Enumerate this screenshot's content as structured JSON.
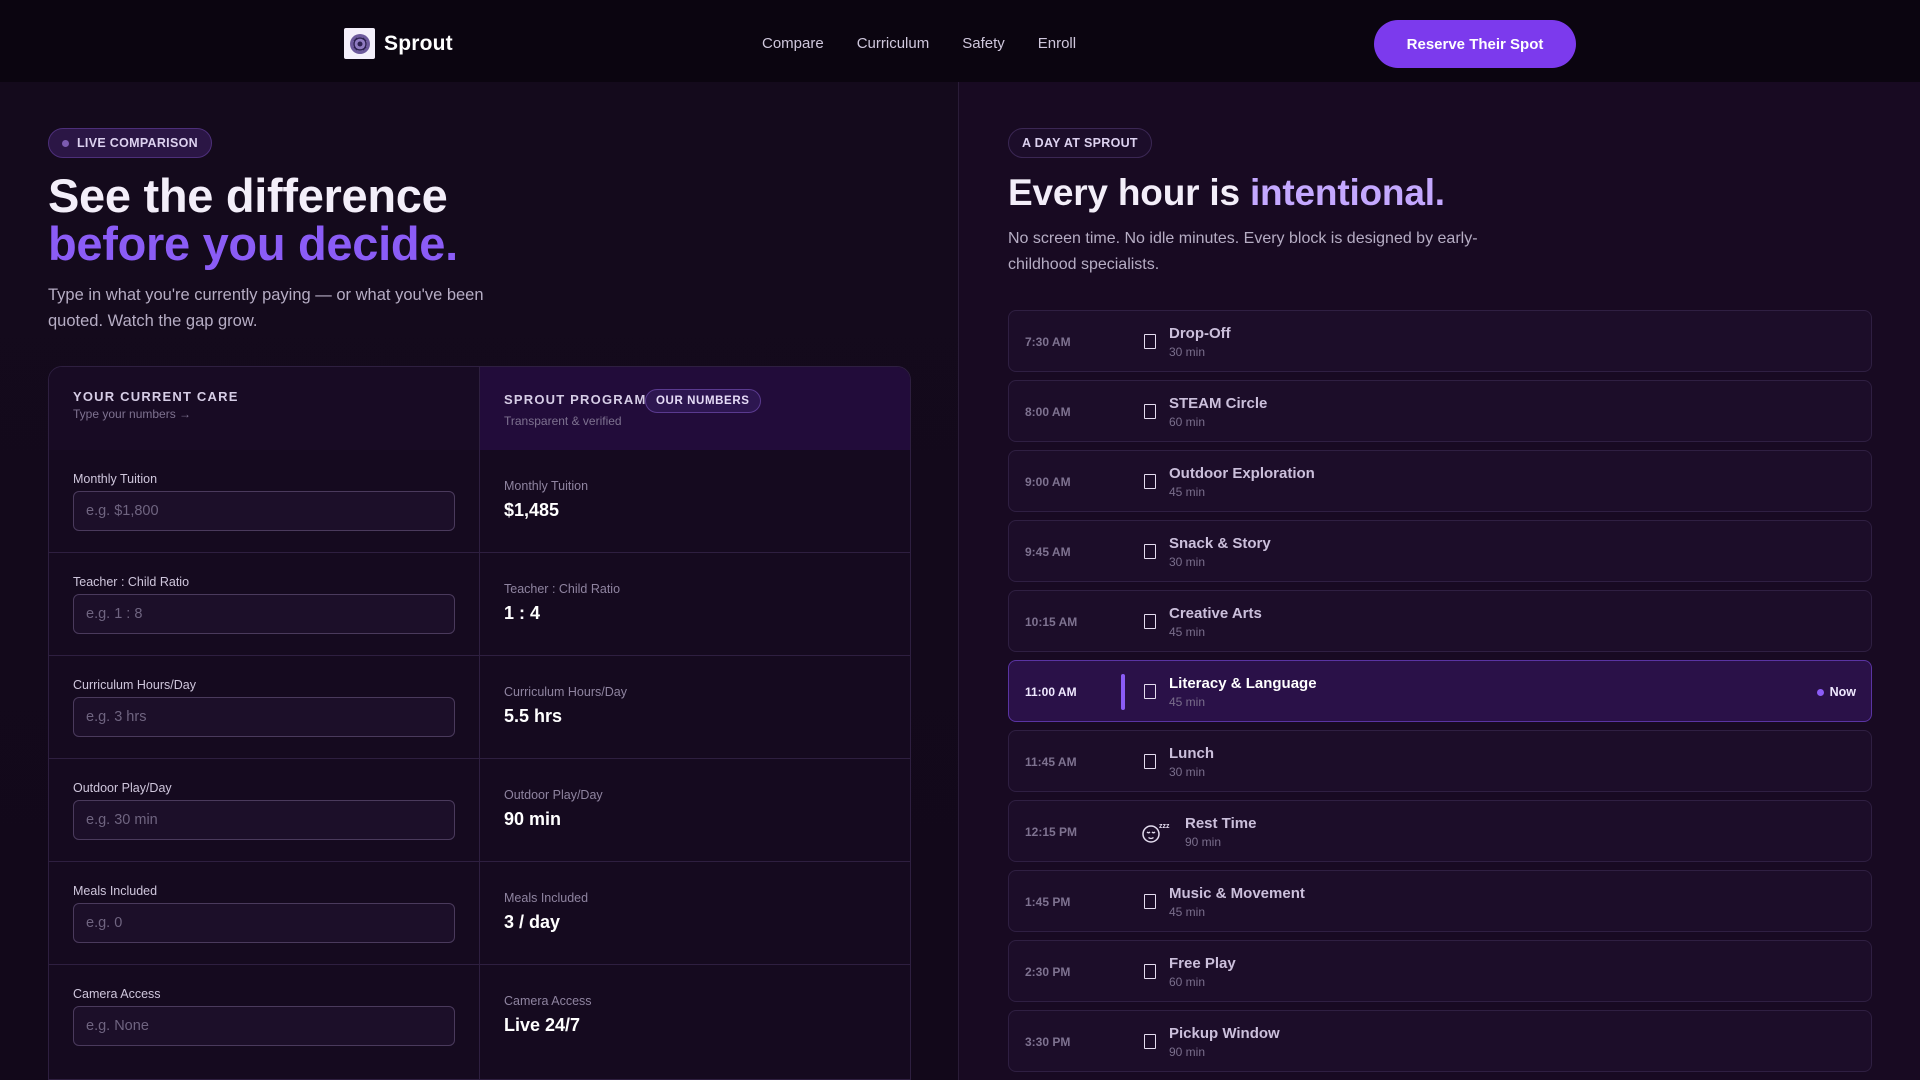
{
  "header": {
    "brand": "Sprout",
    "logo_icon": "sprout-logo-icon",
    "nav": [
      "Compare",
      "Curriculum",
      "Safety",
      "Enroll"
    ],
    "cta": "Reserve Their Spot"
  },
  "compare": {
    "pill": "LIVE COMPARISON",
    "headline_1": "See the difference",
    "headline_2": "before you decide.",
    "lead": "Type in what you're currently paying — or what you've been quoted. Watch the gap grow.",
    "left_title": "YOUR CURRENT CARE",
    "left_sub": "Type your numbers →",
    "right_title": "SPROUT PROGRAM",
    "right_badge": "OUR NUMBERS",
    "right_sub": "Transparent & verified",
    "rows": [
      {
        "label": "Monthly Tuition",
        "placeholder": "e.g. $1,800",
        "value": "$1,485"
      },
      {
        "label": "Teacher : Child Ratio",
        "placeholder": "e.g. 1 : 8",
        "value": "1 : 4"
      },
      {
        "label": "Curriculum Hours/Day",
        "placeholder": "e.g. 3 hrs",
        "value": "5.5 hrs"
      },
      {
        "label": "Outdoor Play/Day",
        "placeholder": "e.g. 30 min",
        "value": "90 min"
      },
      {
        "label": "Meals Included",
        "placeholder": "e.g. 0",
        "value": "3 / day"
      },
      {
        "label": "Camera Access",
        "placeholder": "e.g. None",
        "value": "Live 24/7"
      }
    ]
  },
  "day": {
    "pill": "A DAY AT SPROUT",
    "headline": "Every hour is",
    "headline_accent": "intentional.",
    "sub": "No screen time. No idle minutes. Every block is designed by early-childhood specialists.",
    "now_label": "Now",
    "schedule": [
      {
        "time": "7:30 AM",
        "title": "Drop-Off",
        "duration": "30 min"
      },
      {
        "time": "8:00 AM",
        "title": "STEAM Circle",
        "duration": "60 min"
      },
      {
        "time": "9:00 AM",
        "title": "Outdoor Exploration",
        "duration": "45 min"
      },
      {
        "time": "9:45 AM",
        "title": "Snack & Story",
        "duration": "30 min"
      },
      {
        "time": "10:15 AM",
        "title": "Creative Arts",
        "duration": "45 min"
      },
      {
        "time": "11:00 AM",
        "title": "Literacy & Language",
        "duration": "45 min"
      },
      {
        "time": "11:45 AM",
        "title": "Lunch",
        "duration": "30 min"
      },
      {
        "time": "12:15 PM",
        "title": "Rest Time",
        "duration": "90 min"
      },
      {
        "time": "1:45 PM",
        "title": "Music & Movement",
        "duration": "45 min"
      },
      {
        "time": "2:30 PM",
        "title": "Free Play",
        "duration": "60 min"
      },
      {
        "time": "3:30 PM",
        "title": "Pickup Window",
        "duration": "90 min"
      }
    ]
  }
}
